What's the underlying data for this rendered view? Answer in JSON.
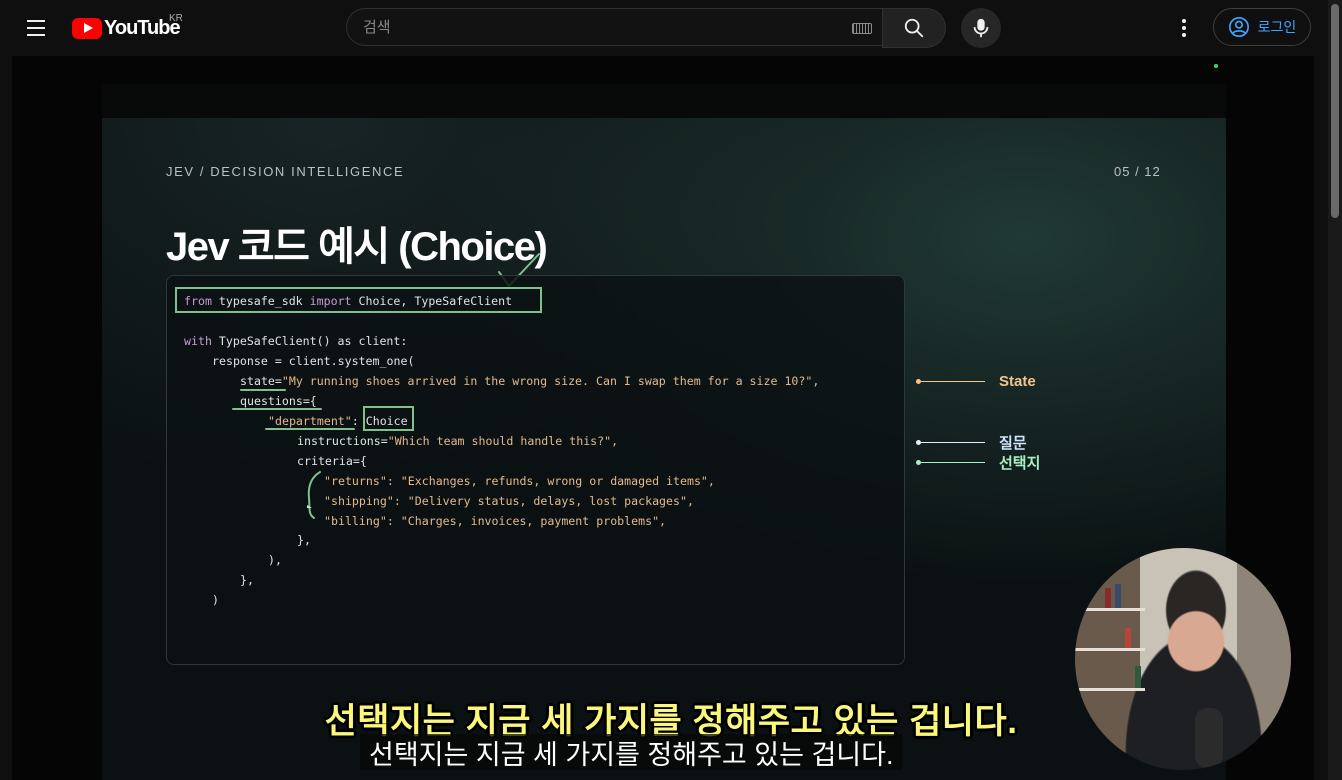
{
  "header": {
    "logo_text": "YouTube",
    "country_code": "KR",
    "search_placeholder": "검색",
    "signin_label": "로그인"
  },
  "slide": {
    "kicker": "JEV / DECISION INTELLIGENCE",
    "page": "05 / 12",
    "title": "Jev 코드 예시 (Choice)",
    "code": {
      "l1_from": "from",
      "l1_mod": " typesafe_sdk ",
      "l1_import": "import",
      "l1_rest": " Choice, TypeSafeClient",
      "l2_with": "with",
      "l2_rest": " TypeSafeClient() as client:",
      "l3": "response = client.system_one(",
      "l4_key": "state=",
      "l4_val": "\"My running shoes arrived in the wrong size. Can I swap them for a size 10?\",",
      "l5": "questions={",
      "l6_key": "\"department\"",
      "l6_sep": ": ",
      "l6_val": "Choice",
      "l7_key": "instructions=",
      "l7_val": "\"Which team should handle this?\",",
      "l8": "criteria={",
      "l9_key": "\"returns\"",
      "l9_val": ": \"Exchanges, refunds, wrong or damaged items\",",
      "l10_key": "\"shipping\"",
      "l10_val": ": \"Delivery status, delays, lost packages\",",
      "l11_key": "\"billing\"",
      "l11_val": ": \"Charges, invoices, payment problems\",",
      "l12": "},",
      "l13": "),",
      "l14": "},",
      "l15": ")"
    },
    "legend": [
      {
        "label": "State",
        "color": "#f3c58e"
      },
      {
        "label": "질문",
        "color": "#cfe3ff"
      },
      {
        "label": "선택지",
        "color": "#a8f0c4"
      }
    ]
  },
  "captions": {
    "burned_in": "선택지는 지금 세 가지를 정해주고 있는 겁니다.",
    "closed_caption": "선택지는 지금 세 가지를 정해주고 있는 겁니다."
  },
  "colors": {
    "accent": "#3ea6ff",
    "brand_red": "#ff0000",
    "annotation_green": "#7fc08e",
    "caption_yellow": "#fbf77a"
  }
}
